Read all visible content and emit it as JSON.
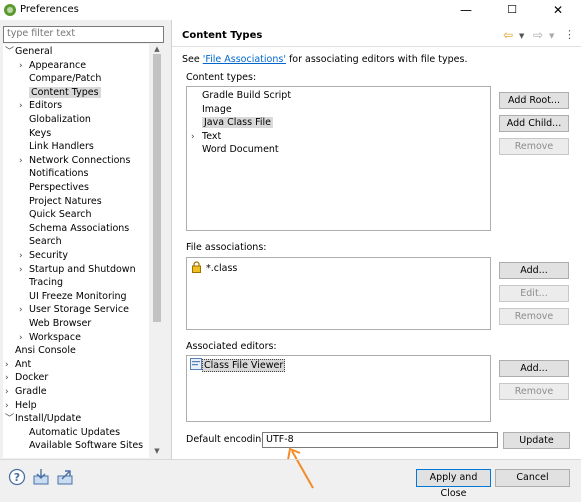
{
  "window": {
    "title": "Preferences",
    "minimize": "—",
    "maximize": "☐",
    "close": "✕"
  },
  "filter": {
    "placeholder": "type filter text"
  },
  "tree": [
    {
      "label": "General",
      "level": 0,
      "arrow": "﹀"
    },
    {
      "label": "Appearance",
      "level": 1,
      "arrow": "›"
    },
    {
      "label": "Compare/Patch",
      "level": 1,
      "arrow": ""
    },
    {
      "label": "Content Types",
      "level": 1,
      "arrow": "",
      "selected": true
    },
    {
      "label": "Editors",
      "level": 1,
      "arrow": "›"
    },
    {
      "label": "Globalization",
      "level": 1,
      "arrow": ""
    },
    {
      "label": "Keys",
      "level": 1,
      "arrow": ""
    },
    {
      "label": "Link Handlers",
      "level": 1,
      "arrow": ""
    },
    {
      "label": "Network Connections",
      "level": 1,
      "arrow": "›"
    },
    {
      "label": "Notifications",
      "level": 1,
      "arrow": ""
    },
    {
      "label": "Perspectives",
      "level": 1,
      "arrow": ""
    },
    {
      "label": "Project Natures",
      "level": 1,
      "arrow": ""
    },
    {
      "label": "Quick Search",
      "level": 1,
      "arrow": ""
    },
    {
      "label": "Schema Associations",
      "level": 1,
      "arrow": ""
    },
    {
      "label": "Search",
      "level": 1,
      "arrow": ""
    },
    {
      "label": "Security",
      "level": 1,
      "arrow": "›"
    },
    {
      "label": "Startup and Shutdown",
      "level": 1,
      "arrow": "›"
    },
    {
      "label": "Tracing",
      "level": 1,
      "arrow": ""
    },
    {
      "label": "UI Freeze Monitoring",
      "level": 1,
      "arrow": ""
    },
    {
      "label": "User Storage Service",
      "level": 1,
      "arrow": "›"
    },
    {
      "label": "Web Browser",
      "level": 1,
      "arrow": ""
    },
    {
      "label": "Workspace",
      "level": 1,
      "arrow": "›"
    },
    {
      "label": "Ansi Console",
      "level": 0,
      "arrow": ""
    },
    {
      "label": "Ant",
      "level": 0,
      "arrow": "›"
    },
    {
      "label": "Docker",
      "level": 0,
      "arrow": "›"
    },
    {
      "label": "Gradle",
      "level": 0,
      "arrow": "›"
    },
    {
      "label": "Help",
      "level": 0,
      "arrow": "›"
    },
    {
      "label": "Install/Update",
      "level": 0,
      "arrow": "﹀"
    },
    {
      "label": "Automatic Updates",
      "level": 1,
      "arrow": ""
    },
    {
      "label": "Available Software Sites",
      "level": 1,
      "arrow": ""
    }
  ],
  "page": {
    "title": "Content Types",
    "desc_prefix": "See ",
    "desc_link": "'File Associations'",
    "desc_suffix": " for associating editors with file types."
  },
  "content_types": {
    "label": "Content types:",
    "items": [
      {
        "label": "Gradle Build Script",
        "arrow": ""
      },
      {
        "label": "Image",
        "arrow": ""
      },
      {
        "label": "Java Class File",
        "arrow": "",
        "selected": true
      },
      {
        "label": "Text",
        "arrow": "›"
      },
      {
        "label": "Word Document",
        "arrow": ""
      }
    ],
    "buttons": {
      "add_root": "Add Root...",
      "add_child": "Add Child...",
      "remove": "Remove"
    }
  },
  "file_associations": {
    "label": "File associations:",
    "items": [
      {
        "label": "*.class"
      }
    ],
    "buttons": {
      "add": "Add...",
      "edit": "Edit...",
      "remove": "Remove"
    }
  },
  "associated_editors": {
    "label": "Associated editors:",
    "items": [
      {
        "label": "Class File Viewer"
      }
    ],
    "buttons": {
      "add": "Add...",
      "remove": "Remove"
    }
  },
  "encoding": {
    "label": "Default encoding:",
    "value": "UTF-8",
    "update": "Update"
  },
  "footer": {
    "apply_close": "Apply and Close",
    "cancel": "Cancel"
  },
  "icons": {
    "help": "help-icon",
    "import": "import-icon",
    "export": "export-icon"
  },
  "colors": {
    "link": "#0066cc",
    "accent": "#0078d7",
    "arrow_annotation": "#f28c28"
  }
}
